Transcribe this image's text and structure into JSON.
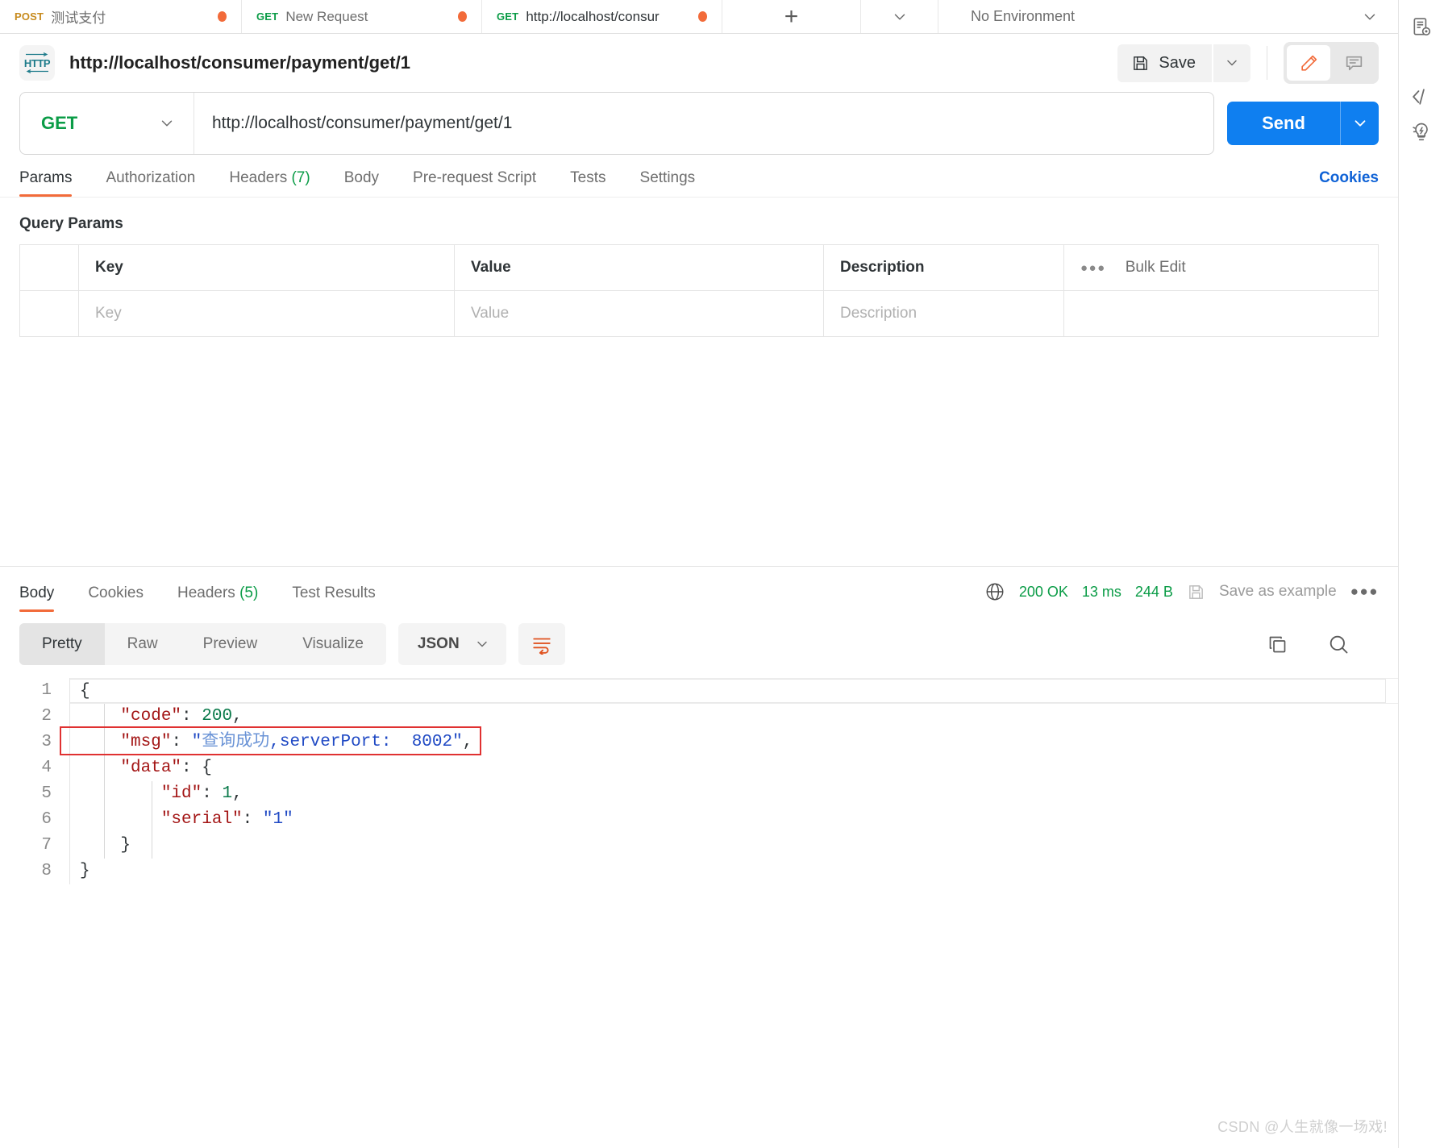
{
  "tabs": [
    {
      "method": "POST",
      "method_class": "m-post",
      "name": "测试支付",
      "dirty": true,
      "active": false
    },
    {
      "method": "GET",
      "method_class": "m-get",
      "name": "New Request",
      "dirty": true,
      "active": false
    },
    {
      "method": "GET",
      "method_class": "m-get",
      "name": "http://localhost/consur",
      "dirty": true,
      "active": true
    }
  ],
  "tabbar": {
    "new_tab_label": "+",
    "environment_label": "No Environment"
  },
  "request": {
    "protocol_badge": "HTTP",
    "title": "http://localhost/consumer/payment/get/1",
    "save_label": "Save",
    "method": "GET",
    "url": "http://localhost/consumer/payment/get/1",
    "send_label": "Send",
    "tabs": [
      {
        "label": "Params",
        "count": "",
        "active": true
      },
      {
        "label": "Authorization",
        "count": "",
        "active": false
      },
      {
        "label": "Headers",
        "count": "(7)",
        "active": false
      },
      {
        "label": "Body",
        "count": "",
        "active": false
      },
      {
        "label": "Pre-request Script",
        "count": "",
        "active": false
      },
      {
        "label": "Tests",
        "count": "",
        "active": false
      },
      {
        "label": "Settings",
        "count": "",
        "active": false
      }
    ],
    "cookies_label": "Cookies"
  },
  "query_params": {
    "section_title": "Query Params",
    "headers": {
      "key": "Key",
      "value": "Value",
      "description": "Description"
    },
    "bulk_edit_label": "Bulk Edit",
    "row_placeholders": {
      "key": "Key",
      "value": "Value",
      "description": "Description"
    }
  },
  "response": {
    "tabs": [
      {
        "label": "Body",
        "count": "",
        "active": true
      },
      {
        "label": "Cookies",
        "count": "",
        "active": false
      },
      {
        "label": "Headers",
        "count": "(5)",
        "active": false
      },
      {
        "label": "Test Results",
        "count": "",
        "active": false
      }
    ],
    "status": "200 OK",
    "time": "13 ms",
    "size": "244 B",
    "save_example_label": "Save as example",
    "view_modes": [
      {
        "label": "Pretty",
        "active": true
      },
      {
        "label": "Raw",
        "active": false
      },
      {
        "label": "Preview",
        "active": false
      },
      {
        "label": "Visualize",
        "active": false
      }
    ],
    "format": "JSON",
    "body_lines": [
      {
        "n": "1",
        "text": "{"
      },
      {
        "n": "2",
        "text": "    \"code\": 200,"
      },
      {
        "n": "3",
        "text": "    \"msg\": \"查询成功,serverPort:  8002\","
      },
      {
        "n": "4",
        "text": "    \"data\": {"
      },
      {
        "n": "5",
        "text": "        \"id\": 1,"
      },
      {
        "n": "6",
        "text": "        \"serial\": \"1\""
      },
      {
        "n": "7",
        "text": "    }"
      },
      {
        "n": "8",
        "text": "}"
      }
    ],
    "body_json": {
      "code": 200,
      "msg": "查询成功,serverPort:  8002",
      "data": {
        "id": 1,
        "serial": "1"
      }
    },
    "highlighted_line": "3"
  },
  "watermark": "CSDN @人生就像一场戏!",
  "colors": {
    "accent_orange": "#f26b3a",
    "send_blue": "#0f7ff0",
    "link_blue": "#0f62d6",
    "get_green": "#0b9c47",
    "post_yellow": "#c78b1e",
    "highlight_red": "#e03131"
  }
}
